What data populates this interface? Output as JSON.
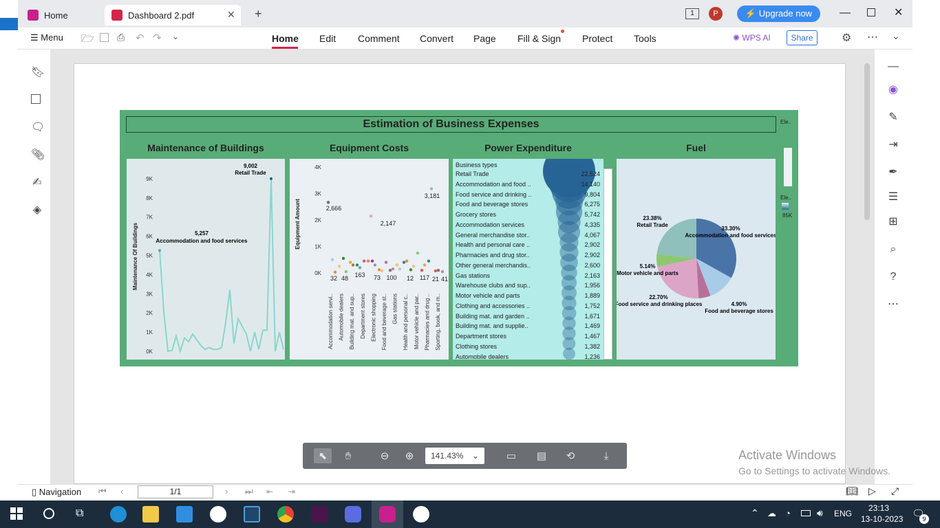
{
  "window": {
    "tab_home": "Home",
    "tab_doc": "Dashboard 2.pdf",
    "upgrade": "Upgrade now",
    "avatar": "P",
    "page_badge": "1"
  },
  "menu": {
    "menu_label": "Menu",
    "items": [
      "Home",
      "Edit",
      "Comment",
      "Convert",
      "Page",
      "Fill & Sign",
      "Protect",
      "Tools"
    ],
    "wps_ai": "WPS AI",
    "share": "Share"
  },
  "dashboard": {
    "title": "Estimation of Business Expenses",
    "side_label_1": "Ele..",
    "side_label_2": "Ele..",
    "side_value": "85K",
    "panels": {
      "maintenance": "Maintenance of Buildings",
      "equipment": "Equipment Costs",
      "power": "Power Expenditure",
      "fuel": "Fuel"
    }
  },
  "chart_data": [
    {
      "type": "line",
      "title": "Maintenance of Buildings",
      "ylabel": "Maintenance Of Buildings",
      "ylim": [
        0,
        9500
      ],
      "yticks": [
        "9K",
        "8K",
        "7K",
        "6K",
        "5K",
        "4K",
        "3K",
        "2K",
        "1K",
        "0K"
      ],
      "values": [
        5257,
        2100,
        0,
        50,
        800,
        0,
        700,
        500,
        900,
        600,
        300,
        100,
        200,
        100,
        100,
        200,
        1500,
        3200,
        400,
        1700,
        1300,
        900,
        0,
        1000,
        100,
        1100,
        1100,
        9002,
        0,
        1000,
        100
      ],
      "annotations": [
        {
          "value": "9,002",
          "label": "Retail Trade"
        },
        {
          "value": "5,257",
          "label": "Accommodation and food services"
        }
      ]
    },
    {
      "type": "scatter",
      "title": "Equipment Costs",
      "ylabel": "Equipment Amount",
      "ylim": [
        0,
        4000
      ],
      "yticks": [
        "4K",
        "3K",
        "2K",
        "1K",
        "0K"
      ],
      "categories": [
        "Accommodation servi..",
        "Automobile dealers",
        "Building mat. and sup..",
        "Department stores",
        "Electronic shopping",
        "Food and beverage st..",
        "Gas stations",
        "Health and personal c..",
        "Motor vehicle and par..",
        "Pharmacies and drug ..",
        "Sporting, book, and m.."
      ],
      "point_labels": [
        "2,666",
        "3,181",
        "2,147",
        "32",
        "48",
        "163",
        "73",
        "100",
        "12",
        "117",
        "21",
        "41"
      ]
    },
    {
      "type": "table",
      "title": "Power Expenditure",
      "header": "Business types",
      "rows": [
        [
          "Retail Trade",
          "22,524"
        ],
        [
          "Accommodation and food ..",
          "14,140"
        ],
        [
          "Food service and drinking ..",
          "9,804"
        ],
        [
          "Food and beverage stores",
          "6,275"
        ],
        [
          "Grocery stores",
          "5,742"
        ],
        [
          "Accommodation services",
          "4,335"
        ],
        [
          "General merchandise stor..",
          "4,067"
        ],
        [
          "Health and personal care ..",
          "2,902"
        ],
        [
          "Pharmacies and drug stor..",
          "2,902"
        ],
        [
          "Other general merchandis..",
          "2,600"
        ],
        [
          "Gas stations",
          "2,163"
        ],
        [
          "Warehouse clubs and sup..",
          "1,956"
        ],
        [
          "Motor vehicle and parts",
          "1,889"
        ],
        [
          "Clothing and accessories ..",
          "1,752"
        ],
        [
          "Building mat. and garden ..",
          "1,671"
        ],
        [
          "Building mat. and supplie..",
          "1,469"
        ],
        [
          "Department stores",
          "1,467"
        ],
        [
          "Clothing stores",
          "1,382"
        ],
        [
          "Automobile dealers",
          "1,236"
        ]
      ]
    },
    {
      "type": "pie",
      "title": "Fuel",
      "slices": [
        {
          "pct": "33.30%",
          "label": "Accommodation and food services",
          "value": 33.3,
          "color": "#4a73a8"
        },
        {
          "pct": "",
          "label": "",
          "value": 11.25,
          "color": "#a8cbe8"
        },
        {
          "pct": "4.90%",
          "label": "Food and beverage stores",
          "value": 4.9,
          "color": "#b5719a"
        },
        {
          "pct": "22.70%",
          "label": "Food service and drinking places",
          "value": 22.7,
          "color": "#dca5c8"
        },
        {
          "pct": "5.14%",
          "label": "Motor vehicle and parts",
          "value": 5.14,
          "color": "#8dc870"
        },
        {
          "pct": "23.38%",
          "label": "Retail Trade",
          "value": 23.38,
          "color": "#8fc0bb"
        }
      ]
    }
  ],
  "pdf_toolbar": {
    "zoom": "141.43%"
  },
  "status": {
    "navigation": "Navigation",
    "page": "1/1"
  },
  "watermark": {
    "line1": "Activate Windows",
    "line2": "Go to Settings to activate Windows."
  },
  "tray": {
    "lang": "ENG",
    "time": "23:13",
    "date": "13-10-2023",
    "notif": "9"
  }
}
